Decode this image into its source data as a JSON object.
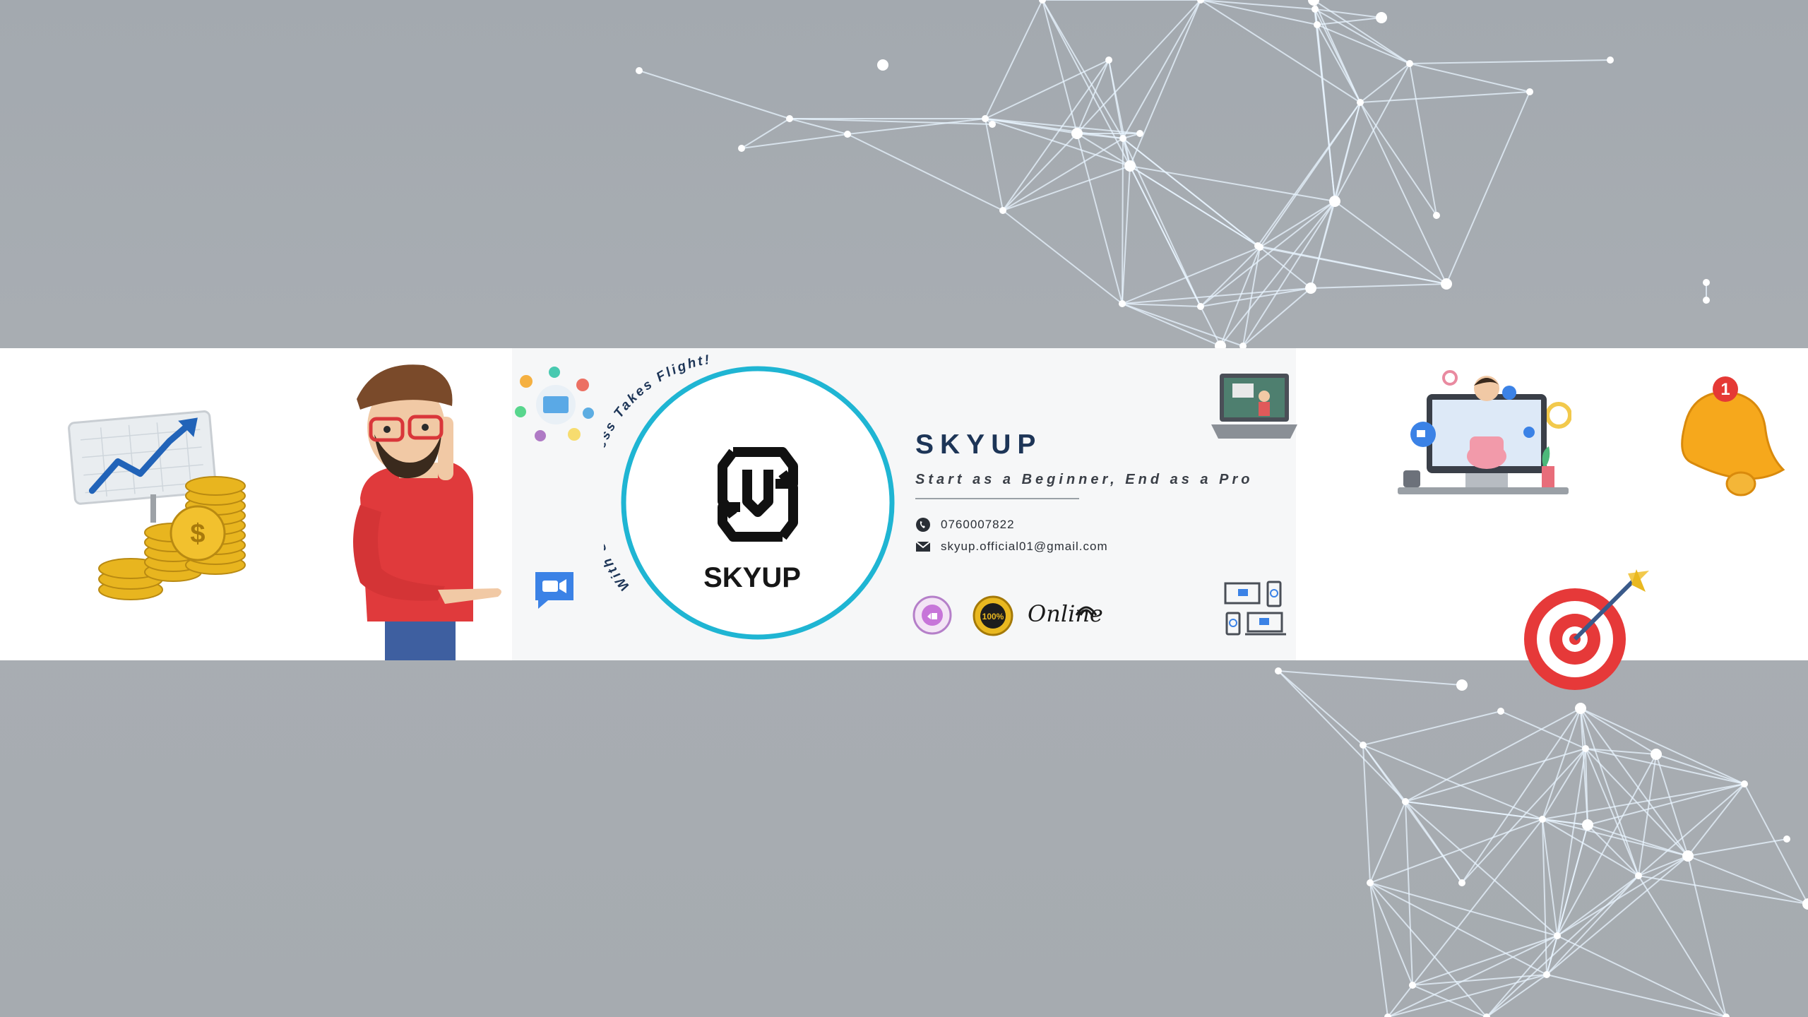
{
  "banner": {
    "brand_name": "SKYUP",
    "tagline": "Start as a Beginner, End as a Pro",
    "logo_text": "SKYUP",
    "arc_slogan": "With Skyup, Success Takes Flight!",
    "phone": "0760007822",
    "email": "skyup.official01@gmail.com",
    "online_label": "Online",
    "bell_badge": "1",
    "coin_symbol": "$",
    "gold_badge_text": "100%"
  },
  "icons": {
    "phone": "phone-icon",
    "email": "mail-icon",
    "bell": "notification-bell-icon",
    "target": "target-dart-icon",
    "growth": "growth-chart-coins-icon",
    "video_chat": "video-chat-icon",
    "laptop": "laptop-lesson-icon",
    "tutor": "online-tutor-monitor-icon",
    "devices": "multi-device-video-icon"
  },
  "colors": {
    "brand_navy": "#1d3557",
    "ring_cyan": "#1fb5d3",
    "gold": "#e9b820",
    "bell_orange": "#f6a81c",
    "target_red": "#e63939",
    "background_gray": "#a7acb1"
  }
}
